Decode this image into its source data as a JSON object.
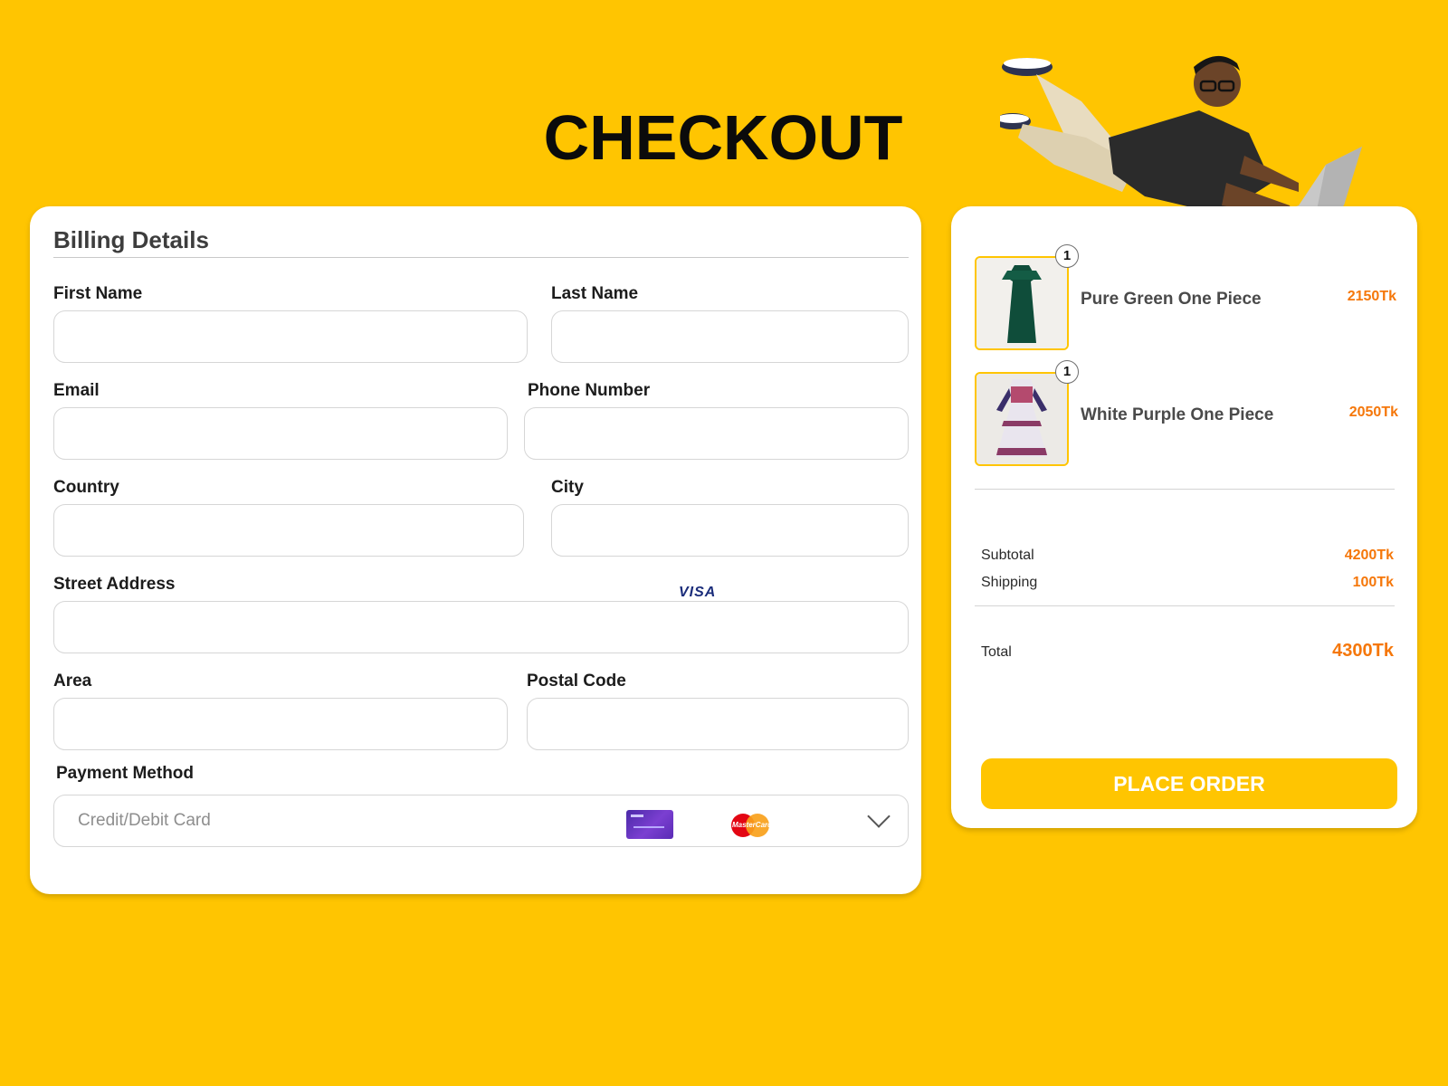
{
  "page": {
    "title": "CHECKOUT"
  },
  "billing": {
    "title": "Billing Details",
    "fields": {
      "first_name": {
        "label": "First Name",
        "value": ""
      },
      "last_name": {
        "label": "Last Name",
        "value": ""
      },
      "email": {
        "label": "Email",
        "value": ""
      },
      "phone": {
        "label": "Phone Number",
        "value": ""
      },
      "country": {
        "label": "Country",
        "value": ""
      },
      "city": {
        "label": "City",
        "value": ""
      },
      "street": {
        "label": "Street Address",
        "value": ""
      },
      "area": {
        "label": "Area",
        "value": ""
      },
      "postal": {
        "label": "Postal Code",
        "value": ""
      }
    },
    "payment": {
      "label": "Payment Method",
      "selected": "Credit/Debit Card",
      "visa_text": "VISA",
      "mastercard_text": "MasterCard"
    }
  },
  "summary": {
    "items": [
      {
        "qty": "1",
        "name": "Pure Green One Piece",
        "price": "2150Tk"
      },
      {
        "qty": "1",
        "name": "White Purple One Piece",
        "price": "2050Tk"
      }
    ],
    "subtotal_label": "Subtotal",
    "subtotal_value": "4200Tk",
    "shipping_label": "Shipping",
    "shipping_value": "100Tk",
    "total_label": "Total",
    "total_value": "4300Tk",
    "place_order_label": "PLACE ORDER"
  },
  "colors": {
    "background": "#FFC501",
    "accent_price": "#F5770A",
    "button": "#FFC501"
  },
  "icons": [
    "visa-icon",
    "credit-card-icon",
    "mastercard-icon",
    "chevron-down-icon"
  ]
}
